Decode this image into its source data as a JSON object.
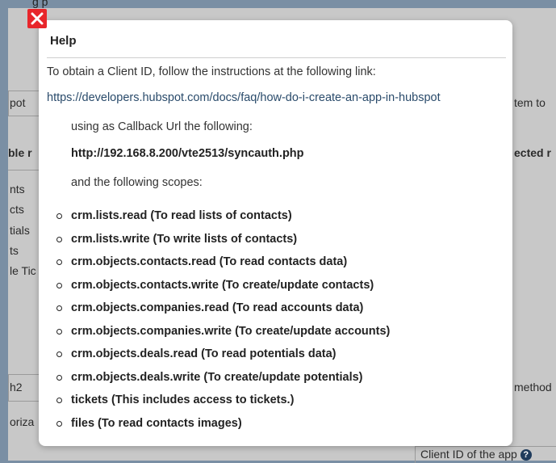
{
  "background": {
    "header_partial": "g       p",
    "left_labels": [
      "pot",
      "ble r",
      "nts",
      "cts",
      "tials",
      "ts",
      "le Tic",
      "h2",
      "oriza"
    ],
    "right_labels": [
      "tem to",
      "ected r",
      "method",
      "Client ID of the app"
    ],
    "help_glyph": "?"
  },
  "dialog": {
    "close_icon": "close-icon",
    "close_color": "#e8262b",
    "title": "Help",
    "intro": "To obtain a Client ID, follow the instructions at the following link:",
    "link": "https://developers.hubspot.com/docs/faq/how-do-i-create-an-app-in-hubspot",
    "callback_label": "using as Callback Url the following:",
    "callback_url": "http://192.168.8.200/vte2513/syncauth.php",
    "scopes_label": "and the following scopes:",
    "scopes": [
      "crm.lists.read (To read lists of contacts)",
      "crm.lists.write (To write lists of contacts)",
      "crm.objects.contacts.read (To read contacts data)",
      "crm.objects.contacts.write (To create/update contacts)",
      "crm.objects.companies.read (To read accounts data)",
      "crm.objects.companies.write (To create/update accounts)",
      "crm.objects.deals.read (To read potentials data)",
      "crm.objects.deals.write (To create/update potentials)",
      "tickets (This includes access to tickets.)",
      "files (To read contacts images)"
    ]
  },
  "colors": {
    "link": "#2a4b6b",
    "overlay": "#7a8fa4"
  }
}
